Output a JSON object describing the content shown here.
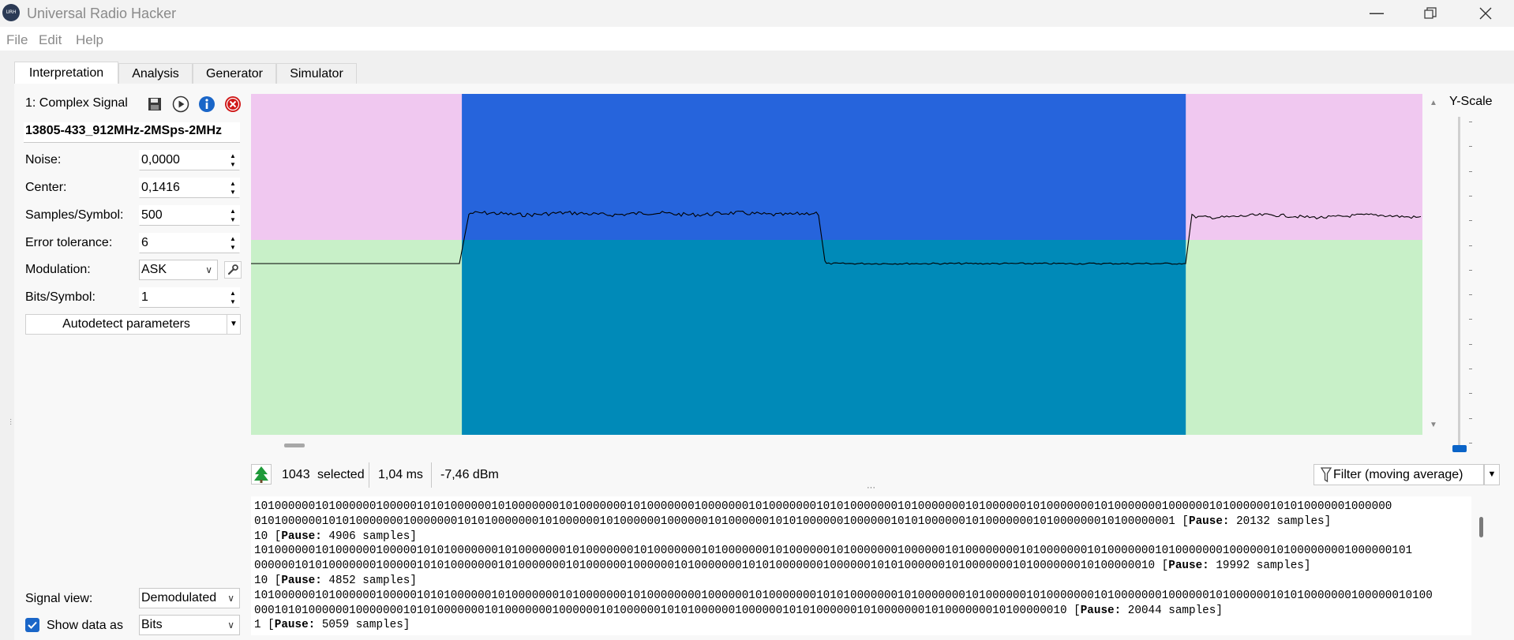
{
  "window": {
    "title": "Universal Radio Hacker",
    "app_icon_text": "URH",
    "minimize_icon": "minimize-icon",
    "maximize_icon": "restore-icon",
    "close_icon": "close-icon"
  },
  "menu": [
    "File",
    "Edit",
    "Help"
  ],
  "tabs": [
    "Interpretation",
    "Analysis",
    "Generator",
    "Simulator"
  ],
  "signal": {
    "header": "1:  Complex Signal",
    "filename": "13805-433_912MHz-2MSps-2MHz",
    "params": [
      {
        "label": "Noise:",
        "value": "0,0000"
      },
      {
        "label": "Center:",
        "value": "0,1416"
      },
      {
        "label": "Samples/Symbol:",
        "value": "500"
      },
      {
        "label": "Error tolerance:",
        "value": "6"
      }
    ],
    "modulation_label": "Modulation:",
    "modulation_value": "ASK",
    "bits_label": "Bits/Symbol:",
    "bits_value": "1",
    "autodetect_label": "Autodetect parameters",
    "signal_view_label": "Signal view:",
    "signal_view_value": "Demodulated",
    "show_data_label": "Show data as",
    "show_data_value": "Bits",
    "show_data_checked": true
  },
  "plot": {
    "yscale_label": "Y-Scale",
    "colors": {
      "upper_bg": "#f0c8f0",
      "lower_bg": "#c8f0c8",
      "selection_upper": "#2664dc",
      "selection_lower": "#008ab8"
    },
    "selection_start_fraction": 0.18,
    "selection_end_fraction": 0.798
  },
  "status": {
    "selected_count": "1043",
    "selected_label": "selected",
    "duration": "1,04 ms",
    "power": "-7,46 dBm",
    "filter_label": "Filter (moving average)"
  },
  "bits_lines": [
    {
      "bits": "101000000101000000100000101010000001010000000101000000010100000001000000010100000001010100000001010000000101000000101000000010100000001000000101000000101010000001000000",
      "suffix": ""
    },
    {
      "bits": "0101000000101010000000100000001010100000001010000001010000001000000101000000101010000001000000101010000001010000000101000000010100000001",
      "suffix": "20132 samples]"
    },
    {
      "bits": "10",
      "suffix": "4906 samples]"
    },
    {
      "bits": "101000000101000000100000101010000000101000000010100000001010000000101000000010100000010100000001000000101000000001010000000101000000010100000001000000101000000001000000101",
      "suffix": ""
    },
    {
      "bits": "0000001010100000001000001010100000001010000000101000000100000010100000001010100000001000000101010000001010000000101000000010100000010",
      "suffix": "19992 samples]"
    },
    {
      "bits": "10",
      "suffix": "4852 samples]"
    },
    {
      "bits": "101000000101000000100000101010000001010000000101000000010100000000100000010100000001010100000001010000000101000000101000000010100000001000000101000000101010000000100000010100",
      "suffix": ""
    },
    {
      "bits": "000101010000001000000010101000000010100000001000000101000000101010000001000000101010000001010000000101000000010100000010",
      "suffix": "20044 samples]"
    },
    {
      "bits": "1",
      "suffix": "5059 samples]"
    }
  ],
  "pause_label": "Pause:"
}
